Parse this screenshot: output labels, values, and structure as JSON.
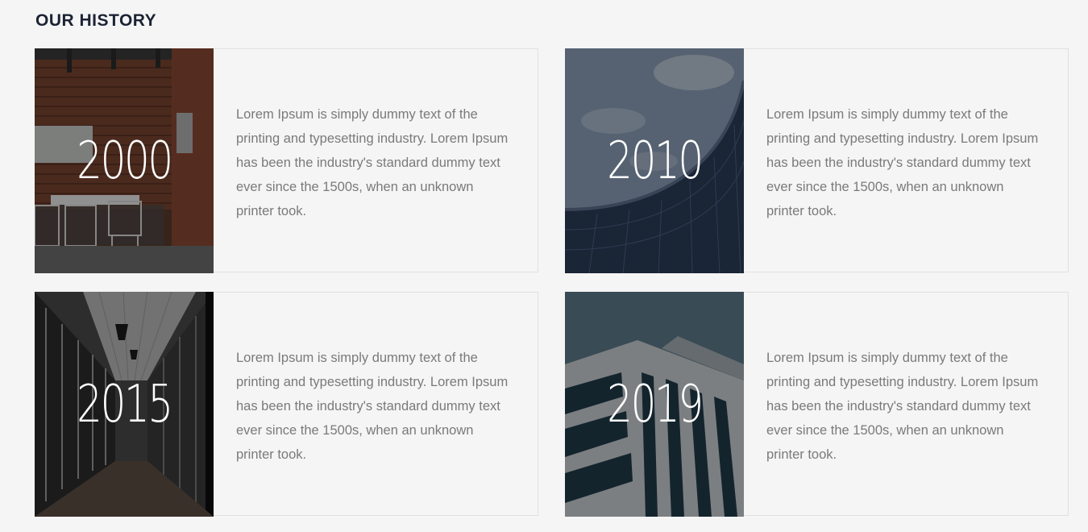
{
  "section": {
    "title": "OUR HISTORY"
  },
  "history": [
    {
      "year": "2000",
      "photo_icon": "office-brick-wall-photo",
      "text": "Lorem Ipsum is simply dummy text of the printing and typesetting industry. Lorem Ipsum has been the industry's standard dummy text ever since the 1500s, when an unknown printer took."
    },
    {
      "year": "2010",
      "photo_icon": "curved-skyscraper-photo",
      "text": "Lorem Ipsum is simply dummy text of the printing and typesetting industry. Lorem Ipsum has been the industry's standard dummy text ever since the 1500s, when an unknown printer took."
    },
    {
      "year": "2015",
      "photo_icon": "office-corridor-photo",
      "text": "Lorem Ipsum is simply dummy text of the printing and typesetting industry. Lorem Ipsum has been the industry's standard dummy text ever since the 1500s, when an unknown printer took."
    },
    {
      "year": "2019",
      "photo_icon": "tower-building-photo",
      "text": "Lorem Ipsum is simply dummy text of the printing and typesetting industry. Lorem Ipsum has been the industry's standard dummy text ever since the 1500s, when an unknown printer took."
    }
  ],
  "colors": {
    "background": "#f5f5f5",
    "title": "#1c2333",
    "body_text": "#7a7a7a",
    "card_border": "#e0e0e0",
    "year_text": "#ffffff"
  }
}
